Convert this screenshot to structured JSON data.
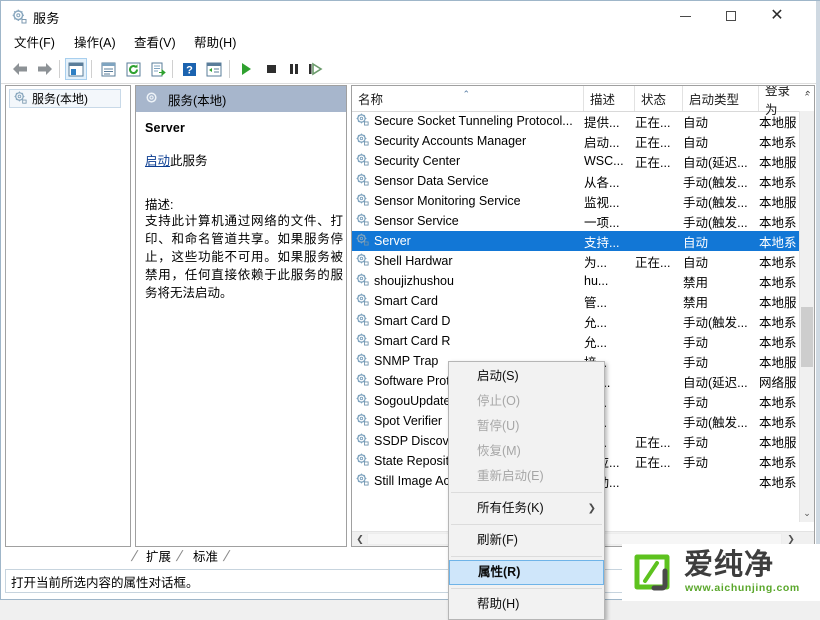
{
  "window": {
    "title": "服务",
    "title_icon": "services-gear-icon",
    "minimize": "—",
    "maximize": "□",
    "close": "✕"
  },
  "menubar": [
    {
      "label": "文件(F)",
      "name": "menu-file"
    },
    {
      "label": "操作(A)",
      "name": "menu-action"
    },
    {
      "label": "查看(V)",
      "name": "menu-view"
    },
    {
      "label": "帮助(H)",
      "name": "menu-help"
    }
  ],
  "toolbar": [
    {
      "name": "back-icon"
    },
    {
      "name": "forward-icon"
    },
    {
      "name": "show-hide-console-tree-icon"
    },
    {
      "name": "properties-icon"
    },
    {
      "name": "refresh-icon"
    },
    {
      "name": "export-list-icon"
    },
    {
      "name": "help-icon"
    },
    {
      "name": "show-hide-action-pane-icon"
    },
    {
      "name": "start-service-icon"
    },
    {
      "name": "stop-service-icon"
    },
    {
      "name": "pause-service-icon"
    },
    {
      "name": "restart-service-icon"
    }
  ],
  "tree": {
    "node_label": "服务(本地)",
    "node_icon": "services-gear-icon"
  },
  "detail": {
    "header": "服务(本地)",
    "header_icon": "services-gear-icon",
    "service_name": "Server",
    "action_link_prefix": "启动",
    "action_link_suffix": "此服务",
    "description_label": "描述:",
    "description": "支持此计算机通过网络的文件、打印、和命名管道共享。如果服务停止，这些功能不可用。如果服务被禁用，任何直接依赖于此服务的服务将无法启动。"
  },
  "list": {
    "columns": [
      {
        "label": "名称",
        "name": "column-name",
        "sorted": true,
        "sort_caret": "⌃"
      },
      {
        "label": "描述",
        "name": "column-description"
      },
      {
        "label": "状态",
        "name": "column-status"
      },
      {
        "label": "启动类型",
        "name": "column-startup-type"
      },
      {
        "label": "登录为",
        "name": "column-log-on-as"
      }
    ],
    "scroll_up_caret": "⌃",
    "scroll_down_caret": "⌄",
    "hscroll_left": "❮",
    "hscroll_right": "❯",
    "rows": [
      {
        "name": "Secure Socket Tunneling Protocol...",
        "desc": "提供...",
        "status": "正在...",
        "startup": "自动",
        "logon": "本地服",
        "selected": false
      },
      {
        "name": "Security Accounts Manager",
        "desc": "启动...",
        "status": "正在...",
        "startup": "自动",
        "logon": "本地系",
        "selected": false
      },
      {
        "name": "Security Center",
        "desc": "WSC...",
        "status": "正在...",
        "startup": "自动(延迟...",
        "logon": "本地服",
        "selected": false
      },
      {
        "name": "Sensor Data Service",
        "desc": "从各...",
        "status": "",
        "startup": "手动(触发...",
        "logon": "本地系",
        "selected": false
      },
      {
        "name": "Sensor Monitoring Service",
        "desc": "监视...",
        "status": "",
        "startup": "手动(触发...",
        "logon": "本地服",
        "selected": false
      },
      {
        "name": "Sensor Service",
        "desc": "一项...",
        "status": "",
        "startup": "手动(触发...",
        "logon": "本地系",
        "selected": false
      },
      {
        "name": "Server",
        "desc": "支持...",
        "status": "",
        "startup": "自动",
        "logon": "本地系",
        "selected": true
      },
      {
        "name": "Shell Hardwar",
        "desc": "为...",
        "status": "正在...",
        "startup": "自动",
        "logon": "本地系",
        "selected": false
      },
      {
        "name": "shoujizhushou",
        "desc": "hu...",
        "status": "",
        "startup": "禁用",
        "logon": "本地系",
        "selected": false
      },
      {
        "name": "Smart Card",
        "desc": "管...",
        "status": "",
        "startup": "禁用",
        "logon": "本地服",
        "selected": false
      },
      {
        "name": "Smart Card D",
        "desc": "允...",
        "status": "",
        "startup": "手动(触发...",
        "logon": "本地系",
        "selected": false
      },
      {
        "name": "Smart Card R",
        "desc": "允...",
        "status": "",
        "startup": "手动",
        "logon": "本地系",
        "selected": false
      },
      {
        "name": "SNMP Trap",
        "desc": "接...",
        "status": "",
        "startup": "手动",
        "logon": "本地服",
        "selected": false
      },
      {
        "name": "Software Prot",
        "desc": "启 ...",
        "status": "",
        "startup": "自动(延迟...",
        "logon": "网络服",
        "selected": false
      },
      {
        "name": "SogouUpdate",
        "desc": "提...",
        "status": "",
        "startup": "手动",
        "logon": "本地系",
        "selected": false
      },
      {
        "name": "Spot Verifier",
        "desc": "验...",
        "status": "",
        "startup": "手动(触发...",
        "logon": "本地系",
        "selected": false
      },
      {
        "name": "SSDP Discove",
        "desc": "当...",
        "status": "正在...",
        "startup": "手动",
        "logon": "本地服",
        "selected": false
      },
      {
        "name": "State Repository Service",
        "desc": "为应...",
        "status": "正在...",
        "startup": "手动",
        "logon": "本地系",
        "selected": false
      },
      {
        "name": "Still Image Acquisition Events",
        "desc": "启动...",
        "status": "",
        "startup": "",
        "logon": "本地系",
        "selected": false
      }
    ]
  },
  "context_menu": {
    "items": [
      {
        "label": "启动(S)",
        "name": "ctx-start",
        "disabled": false,
        "highlighted": false,
        "submenu": false
      },
      {
        "label": "停止(O)",
        "name": "ctx-stop",
        "disabled": true,
        "highlighted": false,
        "submenu": false
      },
      {
        "label": "暂停(U)",
        "name": "ctx-pause",
        "disabled": true,
        "highlighted": false,
        "submenu": false
      },
      {
        "label": "恢复(M)",
        "name": "ctx-resume",
        "disabled": true,
        "highlighted": false,
        "submenu": false
      },
      {
        "label": "重新启动(E)",
        "name": "ctx-restart",
        "disabled": true,
        "highlighted": false,
        "submenu": false
      },
      {
        "separator": true
      },
      {
        "label": "所有任务(K)",
        "name": "ctx-all-tasks",
        "disabled": false,
        "highlighted": false,
        "submenu": true,
        "submenu_caret": "❯"
      },
      {
        "separator": true
      },
      {
        "label": "刷新(F)",
        "name": "ctx-refresh",
        "disabled": false,
        "highlighted": false,
        "submenu": false
      },
      {
        "separator": true
      },
      {
        "label": "属性(R)",
        "name": "ctx-properties",
        "disabled": false,
        "highlighted": true,
        "submenu": false
      },
      {
        "separator": true
      },
      {
        "label": "帮助(H)",
        "name": "ctx-help",
        "disabled": false,
        "highlighted": false,
        "submenu": false
      }
    ]
  },
  "tabs": [
    {
      "label": "扩展",
      "name": "tab-extended",
      "active": false
    },
    {
      "label": "标准",
      "name": "tab-standard",
      "active": true
    }
  ],
  "statusbar": {
    "text": "打开当前所选内容的属性对话框。"
  },
  "watermark": {
    "brand": "爱纯净",
    "url": "www.aichunjing.com",
    "logo_color": "#5dc21e",
    "url_color": "#5aa72b"
  },
  "colors": {
    "selection_blue": "#1277d6",
    "menu_highlight": "#cfe6fa",
    "detail_header": "#a7b6cc",
    "link": "#0b3d91"
  }
}
